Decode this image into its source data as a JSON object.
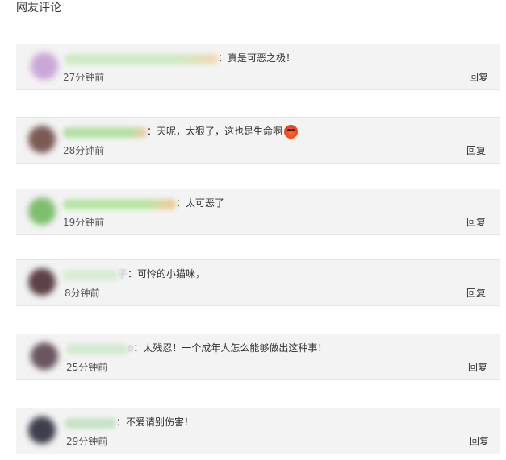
{
  "section_title": "网友评论",
  "reply_label": "回复",
  "comments": [
    {
      "name_tail": "",
      "text": "：真是可恶之极！",
      "time": "27分钟前",
      "avatar_color": "#c9a8d8",
      "name_colors": [
        "#cfe9c4",
        "#f7d6b4"
      ],
      "emoji": false
    },
    {
      "name_tail": "",
      "text": "：天呢，太狠了，这也是生命啊",
      "time": "28分钟前",
      "avatar_color": "#7a5a55",
      "name_colors": [
        "#b4e0a2",
        "#f6c9a8"
      ],
      "emoji": true,
      "emoji_icon": "angry-face-icon"
    },
    {
      "name_tail": "",
      "text": "：太可恶了",
      "time": "19分钟前",
      "avatar_color": "#7dbf6a",
      "name_colors": [
        "#b8e6a6",
        "#f5c896"
      ],
      "emoji": false
    },
    {
      "name_tail": "子",
      "text": "：可怜的小猫咪，",
      "time": "8分钟前",
      "avatar_color": "#5c4246",
      "name_colors": [
        "#d6ecd0",
        "#d6ecd0"
      ],
      "emoji": false
    },
    {
      "name_tail": "o",
      "text": "：太残忍！一个成年人怎么能够做出这种事！",
      "time": "25分钟前",
      "avatar_color": "#6b5560",
      "name_colors": [
        "#d2ead0",
        "#d8e6dc"
      ],
      "emoji": false
    },
    {
      "name_tail": "",
      "text": "：不爱请别伤害！",
      "time": "29分钟前",
      "avatar_color": "#3d3f4d",
      "name_colors": [
        "#c8e2c4",
        "#dfe6e0"
      ],
      "emoji": false
    }
  ]
}
